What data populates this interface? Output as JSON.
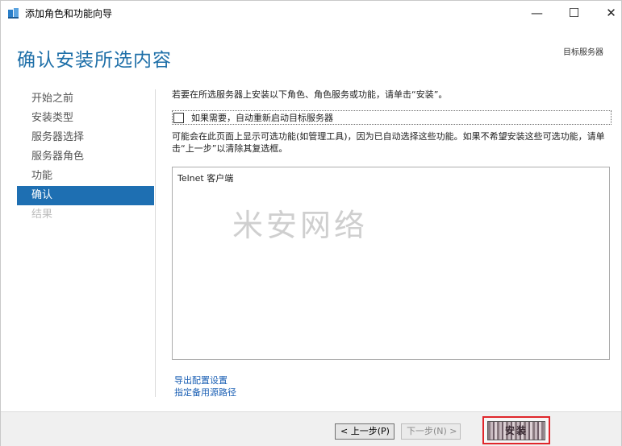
{
  "window": {
    "title": "添加角色和功能向导",
    "minimize": "—",
    "maximize": "☐",
    "close": "✕"
  },
  "page": {
    "title": "确认安装所选内容",
    "target_server_label": "目标服务器"
  },
  "nav": {
    "items": [
      {
        "label": "开始之前",
        "state": "normal"
      },
      {
        "label": "安装类型",
        "state": "normal"
      },
      {
        "label": "服务器选择",
        "state": "normal"
      },
      {
        "label": "服务器角色",
        "state": "normal"
      },
      {
        "label": "功能",
        "state": "normal"
      },
      {
        "label": "确认",
        "state": "active"
      },
      {
        "label": "结果",
        "state": "disabled"
      }
    ]
  },
  "content": {
    "intro": "若要在所选服务器上安装以下角色、角色服务或功能，请单击“安装”。",
    "restart_checkbox_label": "如果需要，自动重新启动目标服务器",
    "restart_checked": false,
    "note": "可能会在此页面上显示可选功能(如管理工具)，因为已自动选择这些功能。如果不希望安装这些可选功能，请单击“上一步”以清除其复选框。",
    "selected_items": [
      "Telnet 客户端"
    ],
    "watermark": "米安网络",
    "link_export": "导出配置设置",
    "link_alternate_source": "指定备用源路径"
  },
  "footer": {
    "prev_label": "< 上一步(P)",
    "next_label": "下一步(N) >",
    "install_label": "安装"
  },
  "colors": {
    "accent": "#1e6fb2",
    "title_blue": "#1e6fa8",
    "highlight_red": "#e0262b"
  }
}
